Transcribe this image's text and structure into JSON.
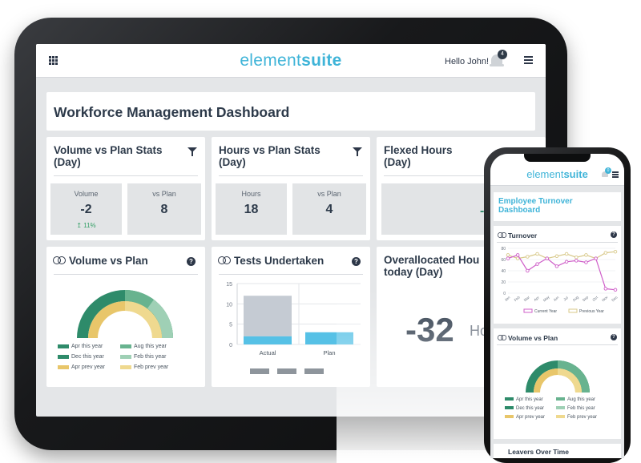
{
  "app": {
    "logo_light": "element",
    "logo_bold": "suite",
    "greeting": "Hello John! ▾",
    "notification_count": "4"
  },
  "dashboard": {
    "title": "Workforce Management Dashboard"
  },
  "volume_stats": {
    "title_line1": "Volume vs Plan Stats",
    "title_line2": "(Day)",
    "volume_label": "Volume",
    "volume_value": "-2",
    "volume_change": "↥ 11%",
    "plan_label": "vs Plan",
    "plan_value": "8"
  },
  "hours_stats": {
    "title_line1": "Hours vs Plan Stats",
    "title_line2": "(Day)",
    "hours_label": "Hours",
    "hours_value": "18",
    "plan_label": "vs Plan",
    "plan_value": "4"
  },
  "flexed": {
    "title_line1": "Flexed Hours",
    "title_line2": "(Day)",
    "value": "-42"
  },
  "volume_plan": {
    "title": "Volume vs Plan",
    "legend": [
      "Apr this year",
      "Aug this year",
      "Dec this year",
      "Feb this year",
      "Apr prev year",
      "Feb prev year"
    ]
  },
  "tests": {
    "title": "Tests Undertaken",
    "categories": [
      "Actual",
      "Plan"
    ],
    "yticks": [
      "0",
      "5",
      "10",
      "15"
    ]
  },
  "overallocated": {
    "title_line1": "Overallocated Hou",
    "title_line2": "today (Day)",
    "value": "-32",
    "unit": "Ho"
  },
  "phone": {
    "title_line1": "Employee Turnover",
    "title_line2": "Dashboard",
    "turnover_title": "Turnover",
    "volume_title": "Volume vs Plan",
    "notification_count": "0",
    "months": [
      "Jan",
      "Feb",
      "Mar",
      "Apr",
      "May",
      "Jun",
      "Jul",
      "Aug",
      "Sep",
      "Oct",
      "Nov",
      "Dec"
    ],
    "yticks": [
      "0",
      "20",
      "40",
      "60",
      "80"
    ],
    "legend": [
      "Current Year",
      "Previous Year"
    ],
    "bottom_title": "Leavers Over Time"
  },
  "colors": {
    "accent": "#3fb4d8",
    "dark_green": "#2e8b6a",
    "mid_green": "#68b38f",
    "light_green": "#9fd0b5",
    "gold": "#e8c66a",
    "light_gold": "#efd98f",
    "bar_gray": "#c5cbd3",
    "bar_blue": "#56c1e6",
    "magenta": "#cf5fc9",
    "khaki": "#d8c98a"
  },
  "chart_data": [
    {
      "type": "bar",
      "title": "Tests Undertaken",
      "categories": [
        "Actual",
        "Plan"
      ],
      "series": [
        {
          "values": [
            12,
            3
          ]
        },
        {
          "values": [
            2,
            3
          ]
        }
      ],
      "ylim": [
        0,
        15
      ]
    },
    {
      "type": "line",
      "title": "Turnover",
      "x": [
        "Jan",
        "Feb",
        "Mar",
        "Apr",
        "May",
        "Jun",
        "Jul",
        "Aug",
        "Sep",
        "Oct",
        "Nov",
        "Dec"
      ],
      "series": [
        {
          "name": "Current Year",
          "values": [
            62,
            68,
            40,
            52,
            62,
            48,
            56,
            58,
            55,
            62,
            8,
            6
          ]
        },
        {
          "name": "Previous Year",
          "values": [
            68,
            62,
            65,
            70,
            62,
            66,
            70,
            64,
            68,
            62,
            72,
            74
          ]
        }
      ],
      "ylim": [
        0,
        80
      ]
    }
  ]
}
